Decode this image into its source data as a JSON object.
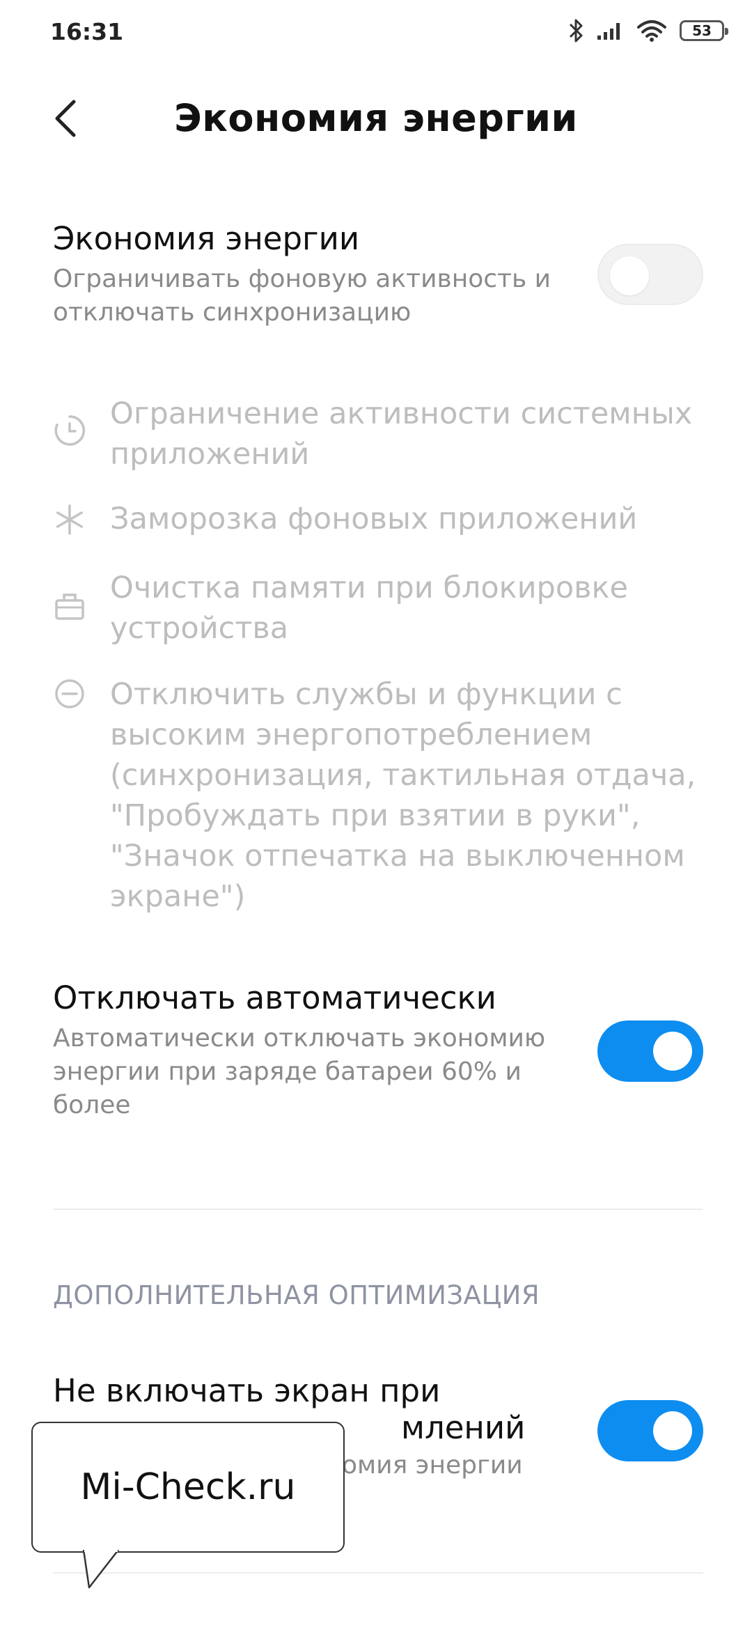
{
  "status_bar": {
    "time": "16:31",
    "battery": "53"
  },
  "header": {
    "title": "Экономия энергии"
  },
  "power_saving": {
    "title": "Экономия энергии",
    "desc_line1": "Ограничивать фоновую активность и",
    "desc_line2": "отключать синхронизацию",
    "enabled": false
  },
  "features": [
    {
      "icon": "clock-icon",
      "line1": "Ограничение активности системных",
      "line2": "приложений"
    },
    {
      "icon": "snowflake-icon",
      "line1": "Заморозка фоновых приложений"
    },
    {
      "icon": "briefcase-icon",
      "line1": "Очистка памяти при блокировке",
      "line2": "устройства"
    },
    {
      "icon": "minus-circle-icon",
      "line1": "Отключить службы и функции с",
      "line2": "высоким энергопотреблением",
      "line3": "(синхронизация, тактильная отдача,",
      "line4": "\"Пробуждать при взятии в руки\",",
      "line5": "\"Значок отпечатка на выключенном",
      "line6": "экране\")"
    }
  ],
  "auto_disable": {
    "title": "Отключать автоматически",
    "desc_line1": "Автоматически отключать экономию",
    "desc_line2": "энергии при заряде батареи 60% и",
    "desc_line3": "более",
    "enabled": true
  },
  "section_additional": {
    "title": "ДОПОЛНИТЕЛЬНАЯ ОПТИМИЗАЦИЯ"
  },
  "screen_on": {
    "title_line1": "Не включать экран при",
    "title_line2_visible": "млений",
    "desc_visible": "омия энергии",
    "enabled": true
  },
  "watermark": {
    "text": "Mi-Check.ru"
  },
  "colors": {
    "accent": "#0d8df0",
    "disabled_text": "#bdbdbd",
    "secondary_text": "#8a8a8a"
  }
}
